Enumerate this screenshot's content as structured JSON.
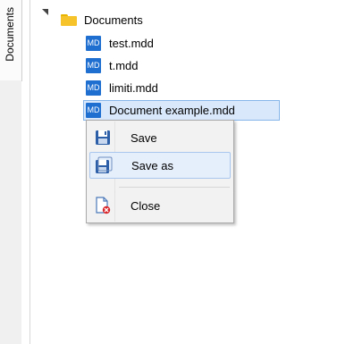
{
  "side_tab": {
    "label": "Documents"
  },
  "tree": {
    "root": {
      "label": "Documents"
    },
    "items": [
      {
        "label": "test.mdd",
        "icon": "md-file-icon",
        "icon_text": "MD"
      },
      {
        "label": "t.mdd",
        "icon": "md-file-icon",
        "icon_text": "MD"
      },
      {
        "label": "limiti.mdd",
        "icon": "md-file-icon",
        "icon_text": "MD"
      },
      {
        "label": "Document example.mdd",
        "icon": "md-file-icon",
        "icon_text": "MD",
        "selected": true
      }
    ]
  },
  "context_menu": {
    "items": [
      {
        "label": "Save",
        "icon": "save-icon"
      },
      {
        "label": "Save as",
        "icon": "save-as-icon",
        "highlighted": true
      },
      {
        "label": "Close",
        "icon": "close-document-icon"
      }
    ]
  },
  "colors": {
    "selection_bg": "#d9e8fb",
    "selection_border": "#86b5ea",
    "md_icon": "#1f6fd1",
    "folder": "#f6c42a"
  }
}
